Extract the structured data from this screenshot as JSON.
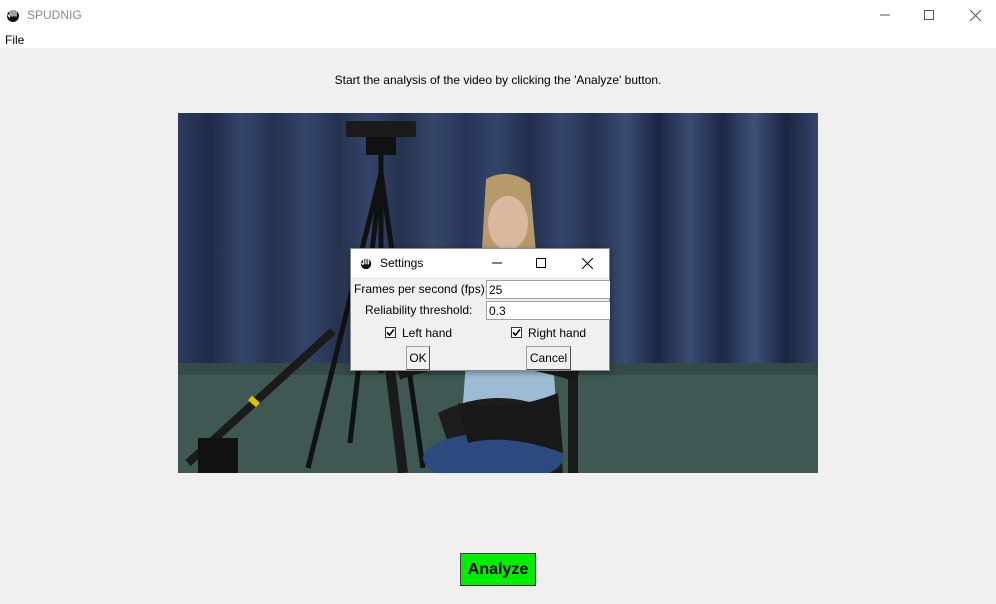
{
  "window": {
    "title": "SPUDNIG",
    "icon": "hand-icon"
  },
  "menu": {
    "file_label": "File"
  },
  "main": {
    "instruction": "Start the analysis of the video by clicking the 'Analyze' button.",
    "analyze_label": "Analyze",
    "analyze_color": "#00ee00"
  },
  "settings_dialog": {
    "title": "Settings",
    "fps_label": "Frames per second (fps):",
    "fps_value": "25",
    "reliability_label": "Reliability threshold:",
    "reliability_value": "0.3",
    "left_hand_label": "Left hand",
    "left_hand_checked": true,
    "right_hand_label": "Right hand",
    "right_hand_checked": true,
    "ok_label": "OK",
    "cancel_label": "Cancel"
  }
}
